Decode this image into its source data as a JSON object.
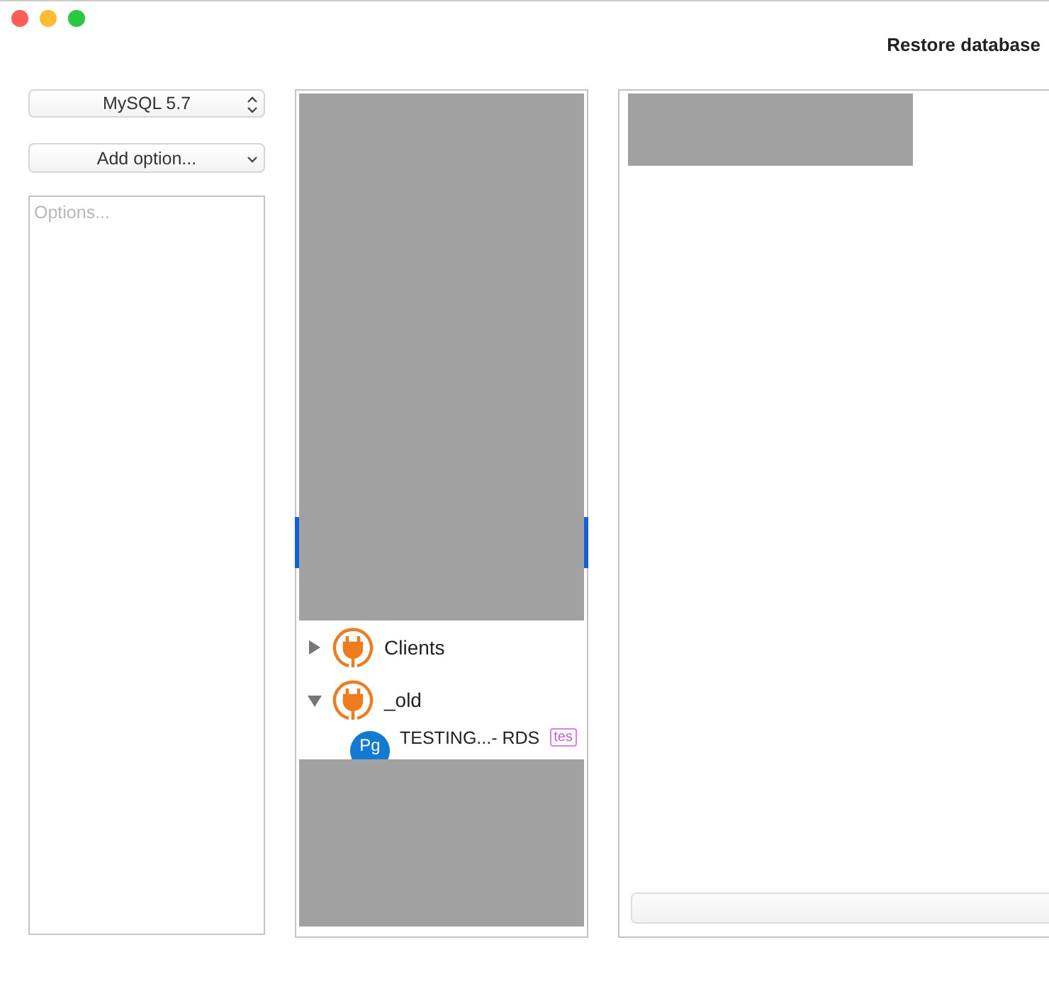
{
  "window": {
    "title": "Restore database"
  },
  "version_select": {
    "value": "MySQL 5.7"
  },
  "add_option": {
    "label": "Add option..."
  },
  "options_field": {
    "placeholder": "Options..."
  },
  "connection_tree": [
    {
      "label": "Clients",
      "expanded": false
    },
    {
      "label": "_old",
      "expanded": true,
      "children": [
        {
          "name": "TESTING...- RDS",
          "tag": "tes",
          "badge": "Pg"
        }
      ]
    }
  ]
}
